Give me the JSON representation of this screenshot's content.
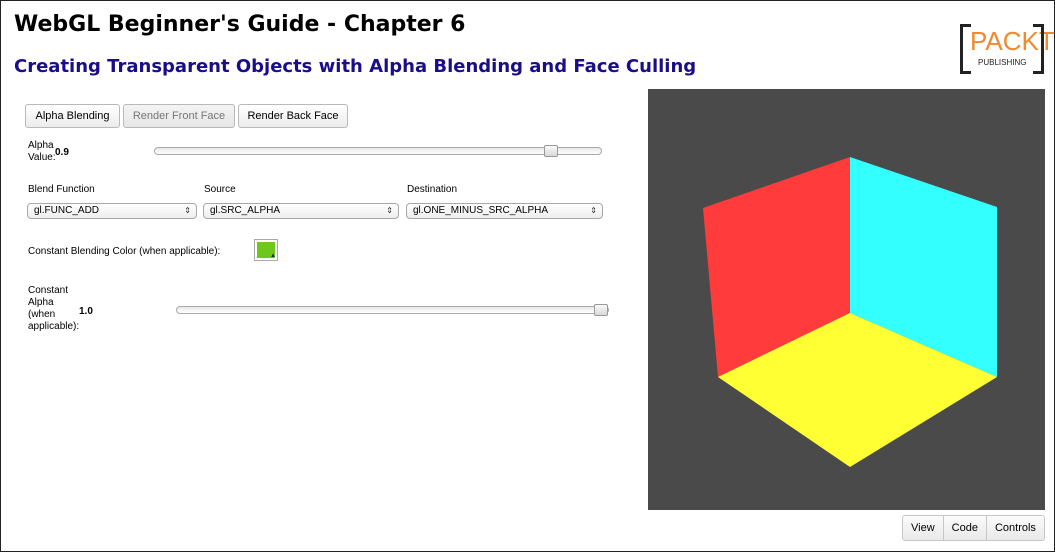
{
  "header": {
    "title": "WebGL Beginner's Guide - Chapter 6",
    "subtitle": "Creating Transparent Objects with Alpha Blending and Face Culling"
  },
  "logo": {
    "brand": "PACKT",
    "tagline": "PUBLISHING",
    "color": "#f08a2c"
  },
  "toolbar": {
    "alpha_blending_label": "Alpha Blending",
    "render_front_face_label": "Render Front Face",
    "render_back_face_label": "Render Back Face"
  },
  "alpha": {
    "label": "Alpha Value:",
    "value": "0.9",
    "fraction": 0.9
  },
  "blend": {
    "function_label": "Blend Function",
    "source_label": "Source",
    "destination_label": "Destination",
    "function_value": "gl.FUNC_ADD",
    "source_value": "gl.SRC_ALPHA",
    "destination_value": "gl.ONE_MINUS_SRC_ALPHA",
    "arrow_glyph": "⇕"
  },
  "constant_color": {
    "label": "Constant Blending Color (when applicable):",
    "color": "#6ec71c"
  },
  "constant_alpha": {
    "label": "Constant Alpha (when applicable):",
    "value": "1.0",
    "fraction": 1.0
  },
  "scene": {
    "background": "#4a4a4a",
    "face_colors": {
      "left": "#ff3b3b",
      "right": "#33ffff",
      "bottom": "#ffff33"
    }
  },
  "bottom_tabs": {
    "view": "View",
    "code": "Code",
    "controls": "Controls"
  }
}
